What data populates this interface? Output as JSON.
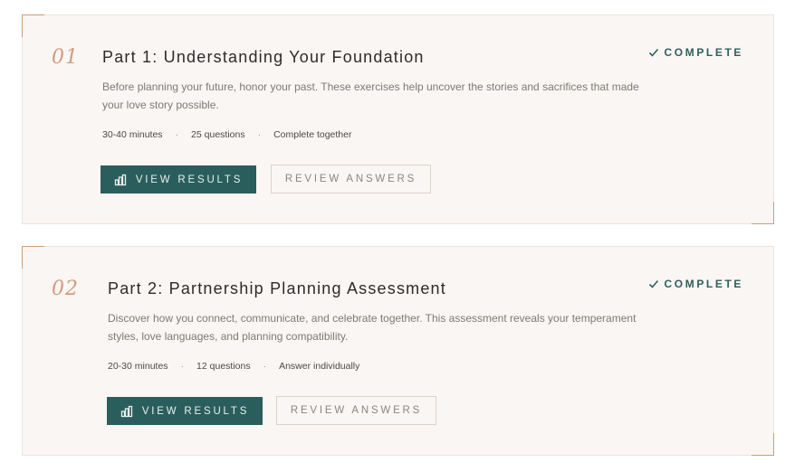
{
  "sections": [
    {
      "number": "01",
      "title": "Part 1: Understanding Your Foundation",
      "description": "Before planning your future, honor your past. These exercises help uncover the stories and sacrifices that made your love story possible.",
      "meta": {
        "duration": "30-40 minutes",
        "questions": "25 questions",
        "mode": "Complete together"
      },
      "status": "COMPLETE",
      "primary_button": "VIEW RESULTS",
      "secondary_button": "REVIEW ANSWERS"
    },
    {
      "number": "02",
      "title": "Part 2: Partnership Planning Assessment",
      "description": "Discover how you connect, communicate, and celebrate together. This assessment reveals your temperament styles, love languages, and planning compatibility.",
      "meta": {
        "duration": "20-30 minutes",
        "questions": "12 questions",
        "mode": "Answer individually"
      },
      "status": "COMPLETE",
      "primary_button": "VIEW RESULTS",
      "secondary_button": "REVIEW ANSWERS"
    }
  ],
  "meta_separator": "·",
  "icons": {
    "status": "check-icon",
    "primary_button": "bar-chart-icon"
  },
  "colors": {
    "accent_teal": "#2a5e5c",
    "number_coral": "#d49a7e",
    "corner_gold": "#c9a07a",
    "card_background": "#faf6f3"
  }
}
